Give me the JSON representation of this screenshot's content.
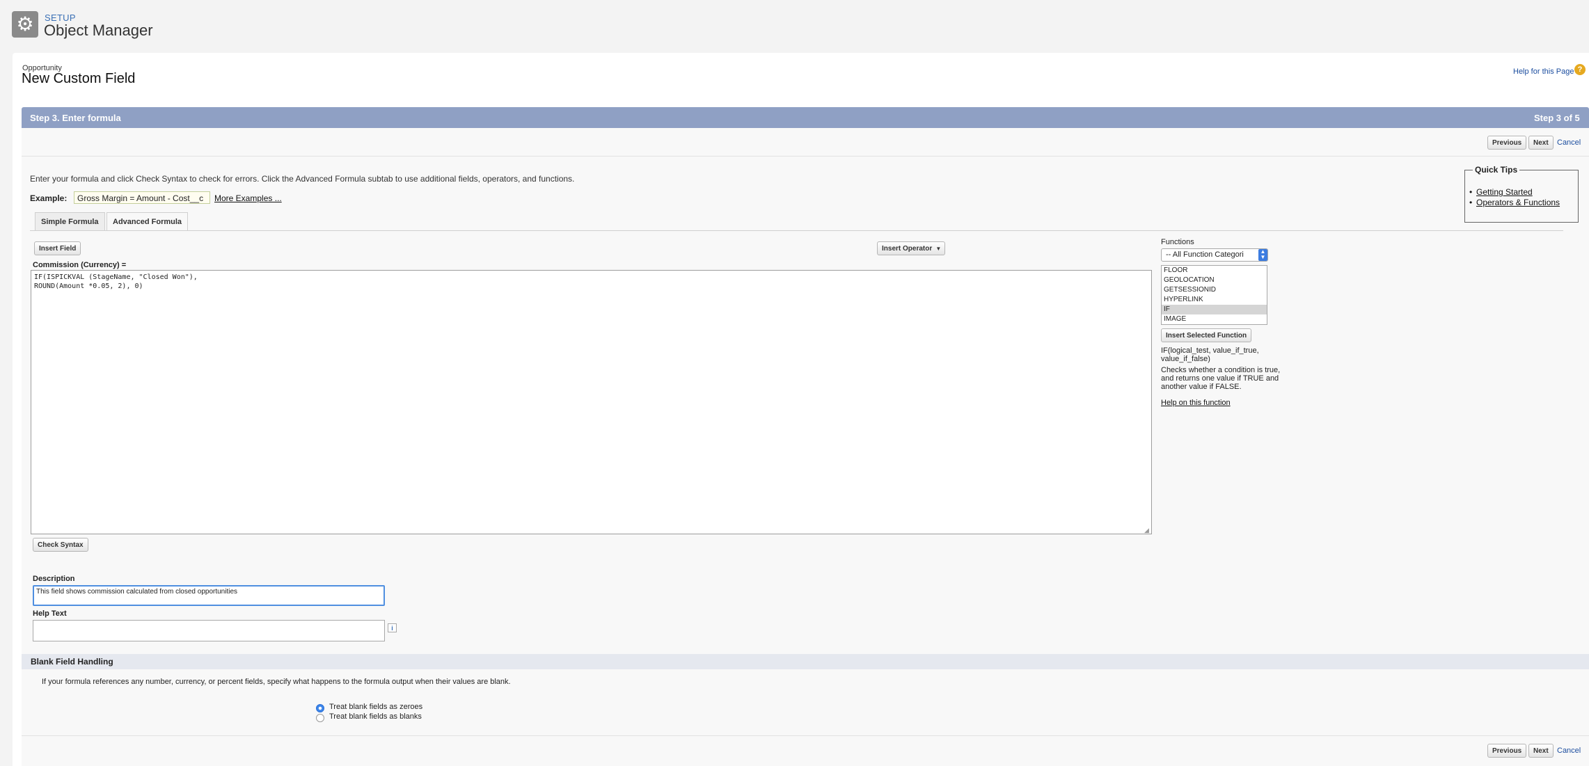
{
  "header": {
    "setup_label": "SETUP",
    "title": "Object Manager",
    "icon": "gear-icon"
  },
  "page": {
    "object_label": "Opportunity",
    "title": "New Custom Field",
    "help_link": "Help for this Page",
    "help_icon": "?"
  },
  "step": {
    "title": "Step 3. Enter formula",
    "count": "Step 3 of 5"
  },
  "nav": {
    "previous": "Previous",
    "next": "Next",
    "cancel": "Cancel"
  },
  "intro": "Enter your formula and click Check Syntax to check for errors. Click the Advanced Formula subtab to use additional fields, operators, and functions.",
  "example": {
    "label": "Example:",
    "value": "Gross Margin = Amount - Cost__c",
    "more_link": "More Examples ..."
  },
  "quick_tips": {
    "title": "Quick Tips",
    "items": [
      "Getting Started",
      "Operators & Functions"
    ]
  },
  "tabs": [
    "Simple Formula",
    "Advanced Formula"
  ],
  "formula": {
    "insert_field": "Insert Field",
    "insert_operator": "Insert Operator",
    "field_label": "Commission (Currency) =",
    "text": "IF(ISPICKVAL (StageName, \"Closed Won\"),\nROUND(Amount *0.05, 2), 0)",
    "check_syntax": "Check Syntax"
  },
  "functions": {
    "label": "Functions",
    "category": "-- All Function Categori",
    "options": [
      "FLOOR",
      "GEOLOCATION",
      "GETSESSIONID",
      "HYPERLINK",
      "IF",
      "IMAGE"
    ],
    "selected": "IF",
    "insert_button": "Insert Selected Function",
    "syntax": "IF(logical_test, value_if_true, value_if_false)",
    "description": "Checks whether a condition is true, and returns one value if TRUE and another value if FALSE.",
    "help_link": "Help on this function"
  },
  "description": {
    "label": "Description",
    "value": "This field shows commission calculated from closed opportunities"
  },
  "help_text": {
    "label": "Help Text",
    "value": "",
    "info_icon": "i"
  },
  "blank_handling": {
    "title": "Blank Field Handling",
    "text": "If your formula references any number, currency, or percent fields, specify what happens to the formula output when their values are blank.",
    "options": [
      "Treat blank fields as zeroes",
      "Treat blank fields as blanks"
    ],
    "selected": "Treat blank fields as zeroes"
  },
  "colors": {
    "step_bar": "#8fa0c4",
    "link": "#1a4c9e",
    "focus": "#4f8fe0"
  }
}
